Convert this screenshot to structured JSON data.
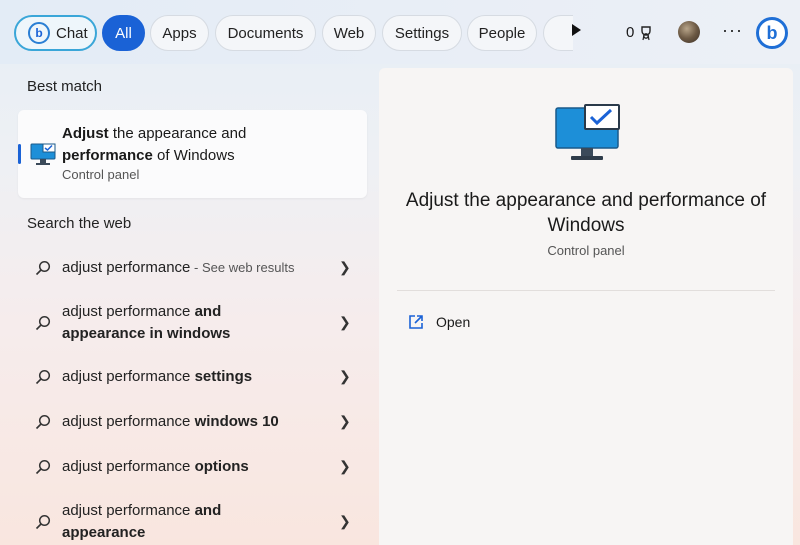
{
  "tabs": {
    "chat": "Chat",
    "all": "All",
    "apps": "Apps",
    "documents": "Documents",
    "web": "Web",
    "settings": "Settings",
    "people": "People"
  },
  "header": {
    "reward_count": "0",
    "more_label": "···"
  },
  "best_match": {
    "section_title": "Best match",
    "title_bold_1": "Adjust",
    "title_rest_1": " the appearance and",
    "title_bold_2": "performance",
    "title_rest_2": " of Windows",
    "subtitle": "Control panel"
  },
  "search_web": {
    "section_title": "Search the web",
    "items": [
      {
        "prefix": "adjust performance",
        "hint": " - See web results",
        "bold": "",
        "line2_prefix": "",
        "line2_bold": ""
      },
      {
        "prefix": "adjust performance ",
        "bold": "and",
        "line2_bold": "appearance in windows"
      },
      {
        "prefix": "adjust performance ",
        "bold": "settings"
      },
      {
        "prefix": "adjust performance ",
        "bold": "windows 10"
      },
      {
        "prefix": "adjust performance ",
        "bold": "options"
      },
      {
        "prefix": "adjust performance ",
        "bold": "and",
        "line2_bold": "appearance"
      }
    ]
  },
  "detail": {
    "title": "Adjust the appearance and performance of Windows",
    "subtitle": "Control panel",
    "open_label": "Open"
  },
  "colors": {
    "accent": "#1a62d6",
    "bing_blue": "#1f6fd6"
  }
}
